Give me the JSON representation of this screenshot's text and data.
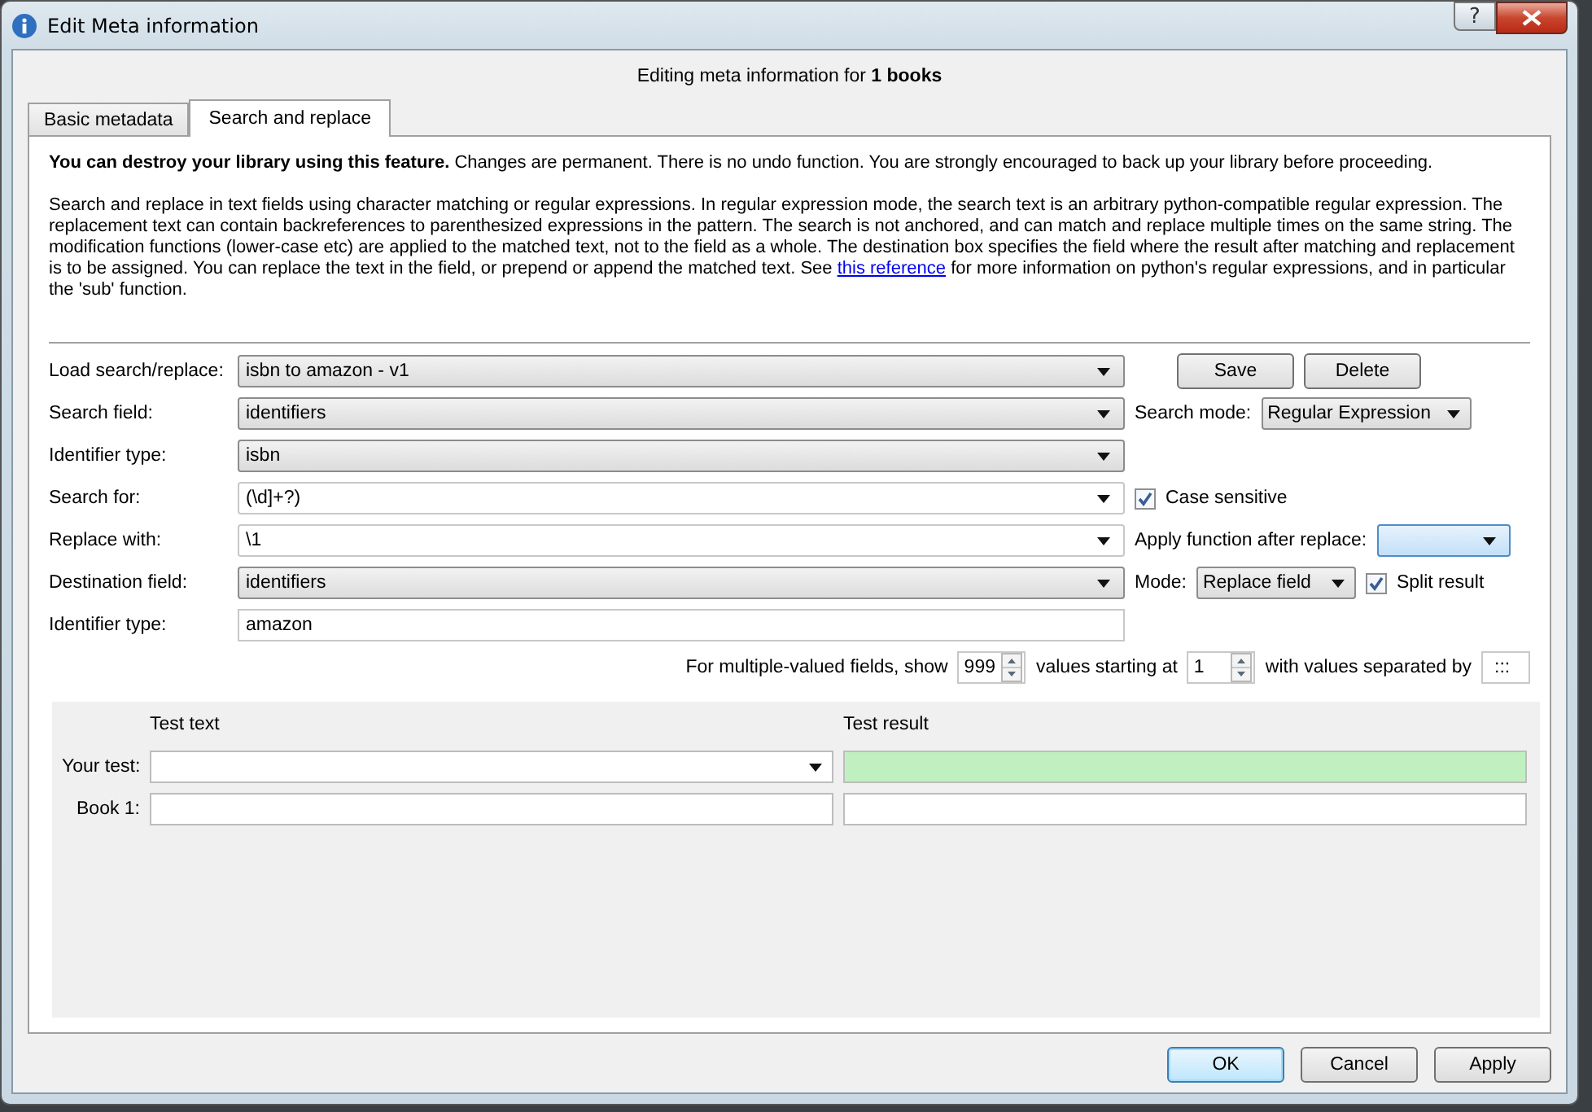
{
  "window": {
    "title": "Edit Meta information",
    "help_button": "?"
  },
  "heading": "Editing meta information for **1 books**",
  "tabs": [
    {
      "label": "Basic metadata",
      "selected": false
    },
    {
      "label": "Search and replace",
      "selected": true
    }
  ],
  "warning": "**You can destroy your library using this feature.** Changes are permanent. There is no undo function. You are strongly encouraged to back up your library before proceeding.",
  "description": {
    "text": "Search and replace in text fields using character matching or regular expressions. In regular expression mode, the search text is an arbitrary python-compatible regular expression. The replacement text can contain backreferences to parenthesized expressions in the pattern. The search is not anchored, and can match and replace multiple times on the same string. The modification functions (lower-case etc) are applied to the matched text, not to the field as a whole. The destination box specifies the field where the result after matching and replacement is to be assigned. You can replace the text in the field, or prepend or append the matched text. See",
    "link": "this reference",
    "after": "for more information on python's regular expressions, and in particular the 'sub' function."
  },
  "load": {
    "label": "Load search/replace:",
    "value": "isbn to amazon - v1",
    "editable": false
  },
  "load_buttons": [
    "Save",
    "Delete"
  ],
  "search_field": {
    "label": "Search field:",
    "value": "identifiers",
    "editable": false
  },
  "search_mode": {
    "label": "Search mode:",
    "value": "Regular Expression"
  },
  "identifier_type": {
    "label": "Identifier type:",
    "value": "isbn",
    "editable": false
  },
  "search_for": {
    "label": "Search for:",
    "value": "(\\d]+?)",
    "editable": true
  },
  "case_sensitive": {
    "label": "Case sensitive",
    "checked": true
  },
  "replace_with": {
    "label": "Replace with:",
    "value": "\\1",
    "editable": true
  },
  "apply_function": {
    "label": "Apply function after replace:"
  },
  "destination_field": {
    "label": "Destination field:",
    "value": "identifiers",
    "editable": false
  },
  "mode": {
    "label": "Mode:",
    "value": "Replace field"
  },
  "split_result": {
    "label": "Split result",
    "checked": true
  },
  "destination_identifier_type": {
    "label": "Identifier type:",
    "value": "amazon"
  },
  "multiple": {
    "label_1": "For multiple-valued fields, show",
    "count": "999",
    "label_2": "values starting at",
    "start": "1",
    "label_3": "with values separated by",
    "separator": ":::"
  },
  "test": {
    "col_1": "Test text",
    "col_2": "Test result",
    "rows": [
      {
        "label": "Your test:",
        "kind": "combo"
      },
      {
        "label": "Book 1:",
        "kind": "plain"
      }
    ]
  },
  "footer_buttons": [
    {
      "label": "OK",
      "default": true
    },
    {
      "label": "Cancel",
      "default": false
    },
    {
      "label": "Apply",
      "default": false
    }
  ]
}
